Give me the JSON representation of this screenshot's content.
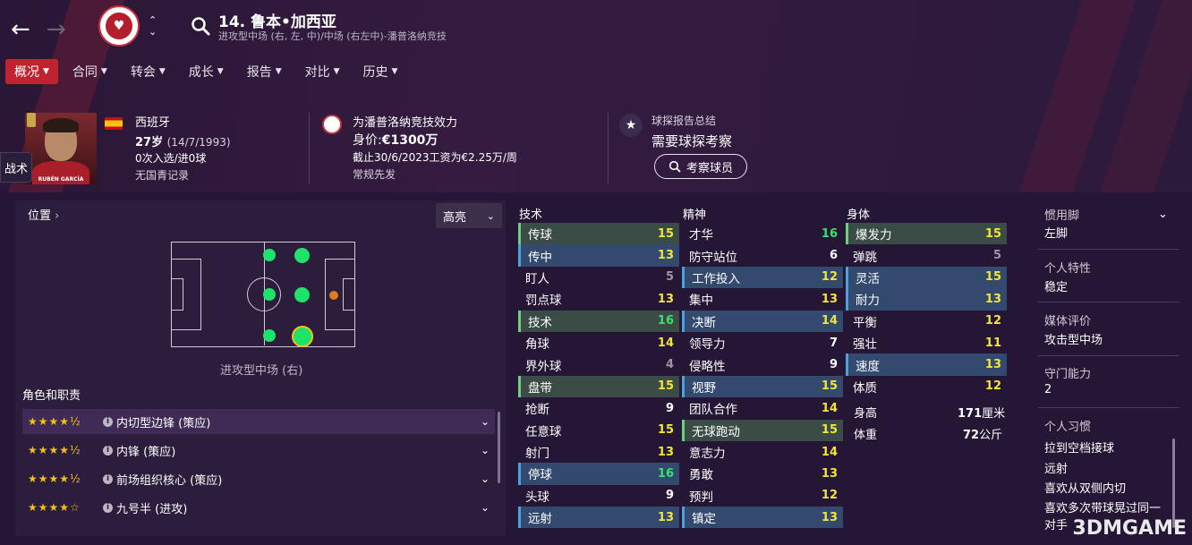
{
  "header": {
    "player_title": "14. 鲁本•加西亚",
    "player_subtitle": "进攻型中场 (右, 左, 中)/中场 (右左中)-潘普洛纳竞技"
  },
  "menu": [
    {
      "label": "概况",
      "active": true
    },
    {
      "label": "合同",
      "active": false
    },
    {
      "label": "转会",
      "active": false
    },
    {
      "label": "成长",
      "active": false
    },
    {
      "label": "报告",
      "active": false
    },
    {
      "label": "对比",
      "active": false
    },
    {
      "label": "历史",
      "active": false
    }
  ],
  "tactics_tab": "战术",
  "photo_name": "RUBÉN GARCÍA",
  "profile": {
    "nationality": "西班牙",
    "age": "27岁",
    "dob": "(14/7/1993)",
    "caps": "0次入选/进0球",
    "youth": "无国青记录"
  },
  "club_info": {
    "plays_for": "为潘普洛纳竞技效力",
    "value_label": "身价:",
    "value": "€1300万",
    "contract": "截止30/6/2023工资为€2.25万/周",
    "status": "常规先发"
  },
  "scout": {
    "heading": "球探报告总结",
    "needs": "需要球探考察",
    "button": "考察球员"
  },
  "position_panel": {
    "heading": "位置",
    "highlight_button": "高亮",
    "position_caption": "进攻型中场 (右)",
    "roles_heading": "角色和职责",
    "roles": [
      {
        "stars": "★★★★½",
        "rating": 4.5,
        "label": "内切型边锋 (策应)"
      },
      {
        "stars": "★★★★½",
        "rating": 4.5,
        "label": "内锋 (策应)"
      },
      {
        "stars": "★★★★½",
        "rating": 4.5,
        "label": "前场组织核心 (策应)"
      },
      {
        "stars": "★★★★☆",
        "rating": 4,
        "label": "九号半 (进攻)"
      }
    ]
  },
  "attributes": {
    "technical_heading": "技术",
    "mental_heading": "精神",
    "physical_heading": "身体",
    "technical": [
      {
        "name": "传球",
        "value": "15",
        "hl": "g"
      },
      {
        "name": "传中",
        "value": "13",
        "hl": "b"
      },
      {
        "name": "盯人",
        "value": "5",
        "hl": ""
      },
      {
        "name": "罚点球",
        "value": "13",
        "hl": ""
      },
      {
        "name": "技术",
        "value": "16",
        "hl": "g"
      },
      {
        "name": "角球",
        "value": "14",
        "hl": ""
      },
      {
        "name": "界外球",
        "value": "4",
        "hl": ""
      },
      {
        "name": "盘带",
        "value": "15",
        "hl": "g"
      },
      {
        "name": "抢断",
        "value": "9",
        "hl": ""
      },
      {
        "name": "任意球",
        "value": "15",
        "hl": ""
      },
      {
        "name": "射门",
        "value": "13",
        "hl": ""
      },
      {
        "name": "停球",
        "value": "16",
        "hl": "b"
      },
      {
        "name": "头球",
        "value": "9",
        "hl": ""
      },
      {
        "name": "远射",
        "value": "13",
        "hl": "b"
      }
    ],
    "mental": [
      {
        "name": "才华",
        "value": "16",
        "hl": ""
      },
      {
        "name": "防守站位",
        "value": "6",
        "hl": ""
      },
      {
        "name": "工作投入",
        "value": "12",
        "hl": "b"
      },
      {
        "name": "集中",
        "value": "13",
        "hl": ""
      },
      {
        "name": "决断",
        "value": "14",
        "hl": "b"
      },
      {
        "name": "领导力",
        "value": "7",
        "hl": ""
      },
      {
        "name": "侵略性",
        "value": "9",
        "hl": ""
      },
      {
        "name": "视野",
        "value": "15",
        "hl": "b"
      },
      {
        "name": "团队合作",
        "value": "14",
        "hl": ""
      },
      {
        "name": "无球跑动",
        "value": "15",
        "hl": "g"
      },
      {
        "name": "意志力",
        "value": "14",
        "hl": ""
      },
      {
        "name": "勇敢",
        "value": "13",
        "hl": ""
      },
      {
        "name": "预判",
        "value": "12",
        "hl": ""
      },
      {
        "name": "镇定",
        "value": "13",
        "hl": "b"
      }
    ],
    "physical": [
      {
        "name": "爆发力",
        "value": "15",
        "hl": "g"
      },
      {
        "name": "弹跳",
        "value": "5",
        "hl": ""
      },
      {
        "name": "灵活",
        "value": "15",
        "hl": "b"
      },
      {
        "name": "耐力",
        "value": "13",
        "hl": "b"
      },
      {
        "name": "平衡",
        "value": "12",
        "hl": ""
      },
      {
        "name": "强壮",
        "value": "11",
        "hl": ""
      },
      {
        "name": "速度",
        "value": "13",
        "hl": "b"
      },
      {
        "name": "体质",
        "value": "12",
        "hl": ""
      }
    ],
    "height_label": "身高",
    "height_num": "171",
    "height_unit": "厘米",
    "weight_label": "体重",
    "weight_num": "72",
    "weight_unit": "公斤"
  },
  "side": {
    "foot_label": "惯用脚",
    "foot_value": "左脚",
    "personality_label": "个人特性",
    "personality_value": "稳定",
    "media_label": "媒体评价",
    "media_value": "攻击型中场",
    "gk_label": "守门能力",
    "gk_value": "2",
    "habits_label": "个人习惯",
    "habits": [
      "拉到空档接球",
      "远射",
      "喜欢从双侧内切",
      "喜欢多次带球晃过同一",
      "对手"
    ]
  },
  "watermark": "3DMGAME"
}
